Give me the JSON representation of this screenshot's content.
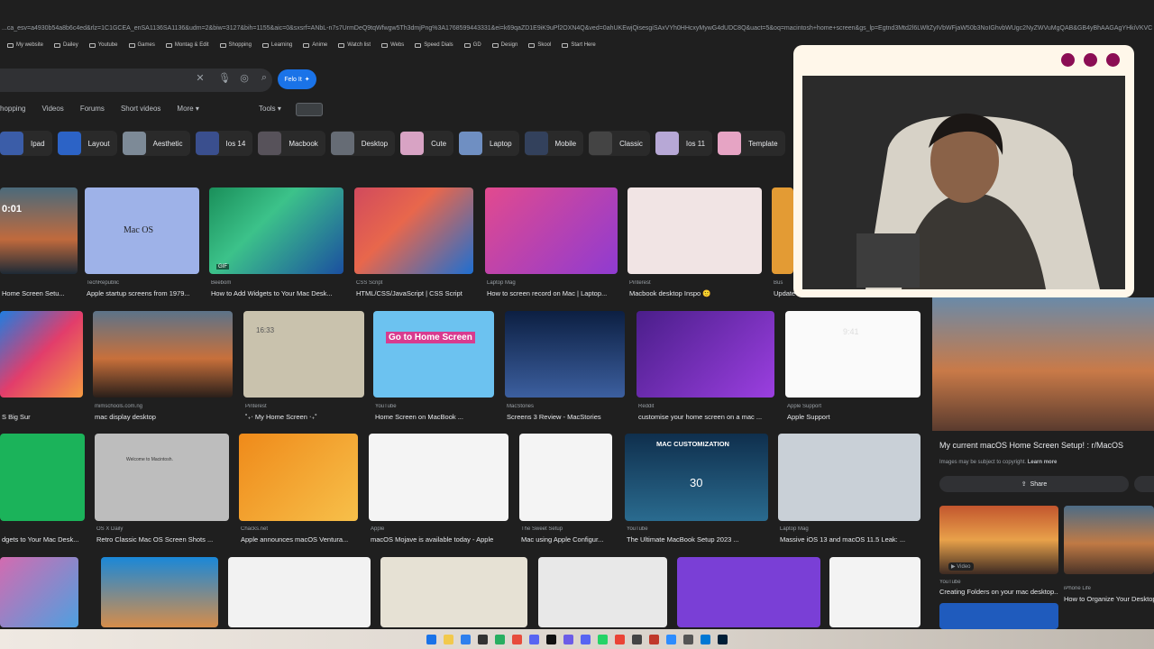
{
  "browser": {
    "url": "...ca_esv=a4930b54a8b6c4ed&rlz=1C1GCEA_enSA1136SA1136&udm=2&biw=3127&bih=1155&aic=0&sxsrf=ANbL-n7s7UrmDeQ9tqWfwgw5Th3dmjPng%3A1768599443331&ei=k69qaZD1E9iK9uPf2OXN4Q&ved=0ahUKEwjQisesgiSAxVYh0HHcxyMywG4dUDC8Q&uact=5&oq=macintosh+home+screen&gs_lp=Egtnd3Mtd2l6LWltZyIVbWFjaW50b3NoIGhvbWUgc2NyZWVuMgQAB&GB4yBhAAGAgYHkiVKVC",
    "bookmarks": [
      "My website",
      "Dailey",
      "Youtube",
      "Games",
      "Montag & Edit",
      "Shopping",
      "Learning",
      "Anime",
      "Watch list",
      "Webs",
      "Speed Dials",
      "GD",
      "Design",
      "Skool",
      "Start Here"
    ]
  },
  "search": {
    "clear_icon": "close-icon",
    "mic_icon": "microphone-icon",
    "lens_icon": "camera-icon",
    "search_icon": "search-icon",
    "felo_label": "Felo It"
  },
  "tabs": [
    "hopping",
    "Videos",
    "Forums",
    "Short videos",
    "More"
  ],
  "tools_label": "Tools",
  "chips": [
    "Ipad",
    "Layout",
    "Aesthetic",
    "Ios 14",
    "Macbook",
    "Desktop",
    "Cute",
    "Laptop",
    "Mobile",
    "Classic",
    "Ios 11",
    "Template"
  ],
  "row1": [
    {
      "src": "",
      "cap": "Home Screen Setu..."
    },
    {
      "src": "TechRepublic",
      "cap": "Apple startup screens from 1979..."
    },
    {
      "src": "Beebom",
      "cap": "How to Add Widgets to Your Mac Desk..."
    },
    {
      "src": "CSS Script",
      "cap": "HTML/CSS/JavaScript | CSS Script"
    },
    {
      "src": "Laptop Mag",
      "cap": "How to screen record on Mac | Laptop..."
    },
    {
      "src": "Pinterest",
      "cap": "Macbook desktop Inspo 🙂"
    },
    {
      "src": "Bus",
      "cap": "Update"
    }
  ],
  "row1_overlay": {
    "gif": "GIF",
    "macos": "Mac OS",
    "clock": "0:01"
  },
  "row2": [
    {
      "src": "",
      "cap": "S Big Sur"
    },
    {
      "src": "mimschools.com.ng",
      "cap": "mac display desktop"
    },
    {
      "src": "Pinterest",
      "cap": "˚₊‧ My Home Screen ‧₊˚"
    },
    {
      "src": "YouTube",
      "cap": "Home Screen on MacBook ..."
    },
    {
      "src": "MacStories",
      "cap": "Screens 3 Review - MacStories"
    },
    {
      "src": "Reddit",
      "cap": "customise your home screen on a mac ..."
    },
    {
      "src": "Apple Support",
      "cap": "Apple Support"
    }
  ],
  "row2_overlay": {
    "go_home": "Go to Home Screen",
    "time": "9:41",
    "clock": "16:33"
  },
  "row3": [
    {
      "src": "",
      "cap": "dgets to Your Mac Desk..."
    },
    {
      "src": "OS X Daily",
      "cap": "Retro Classic Mac OS Screen Shots ..."
    },
    {
      "src": "Chacks.net",
      "cap": "Apple announces macOS Ventura..."
    },
    {
      "src": "Apple",
      "cap": "macOS Mojave is available today - Apple"
    },
    {
      "src": "The Sweet Setup",
      "cap": "Mac using Apple Configur..."
    },
    {
      "src": "YouTube",
      "cap": "The Ultimate MacBook Setup 2023 ..."
    },
    {
      "src": "Laptop Mag",
      "cap": "Massive iOS 13 and macOS 11.5 Leak: ..."
    }
  ],
  "row3_overlay": {
    "customization": "MAC CUSTOMIZATION",
    "day": "30",
    "welcome": "Welcome to Macintosh."
  },
  "panel": {
    "title": "My current macOS Home Screen Setup! : r/MacOS",
    "note": "Images may be subject to copyright.",
    "learn_more": "Learn more",
    "share_label": "Share",
    "related": [
      {
        "src": "YouTube",
        "cap": "Creating Folders on your mac desktop...",
        "badge": "Video"
      },
      {
        "src": "iPhone Life",
        "cap": "How to Organize Your Desktop o..."
      }
    ]
  }
}
